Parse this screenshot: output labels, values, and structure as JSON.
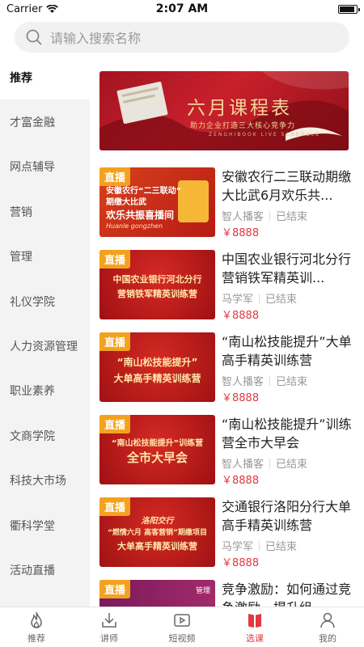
{
  "status": {
    "carrier": "Carrier",
    "time": "2:07 AM"
  },
  "search": {
    "placeholder": "请输入搜索名称"
  },
  "sidebar": {
    "items": [
      {
        "label": "推荐"
      },
      {
        "label": "才富金融"
      },
      {
        "label": "网点辅导"
      },
      {
        "label": "营销"
      },
      {
        "label": "管理"
      },
      {
        "label": "礼仪学院"
      },
      {
        "label": "人力资源管理"
      },
      {
        "label": "职业素养"
      },
      {
        "label": "文商学院"
      },
      {
        "label": "科技大市场"
      },
      {
        "label": "衢科学堂"
      },
      {
        "label": "活动直播"
      }
    ]
  },
  "banner": {
    "title": "六月课程表",
    "subtitle": "助力企业打造三大核心竞争力",
    "subtitle2": "ZENGHIBOOK LIVE SCHEDULE"
  },
  "courses": [
    {
      "badge": "直播",
      "title": "安徽农行二三联动期缴大比武6月欢乐共...",
      "author": "智人播客",
      "status": "已结束",
      "price": "￥8888",
      "thumb_lines": [
        "安徽农行“二三联动”",
        "期缴大比武",
        "欢乐共振喜播间",
        "Huanle gongzhen"
      ]
    },
    {
      "badge": "直播",
      "title": "中国农业银行河北分行营销铁军精英训...",
      "author": "马学军",
      "status": "已结束",
      "price": "￥8888",
      "thumb_lines": [
        "中国农业银行河北分行",
        "营销铁军精英训练营"
      ]
    },
    {
      "badge": "直播",
      "title": "“南山松技能提升”大单高手精英训练营",
      "author": "智人播客",
      "status": "已结束",
      "price": "￥8888",
      "thumb_lines": [
        "“南山松技能提升”",
        "大单高手精英训练营"
      ]
    },
    {
      "badge": "直播",
      "title": "“南山松技能提升”训练营全市大早会",
      "author": "智人播客",
      "status": "已结束",
      "price": "￥8888",
      "thumb_lines": [
        "“南山松技能提升”训练营",
        "全市大早会"
      ]
    },
    {
      "badge": "直播",
      "title": "交通银行洛阳分行大单高手精英训练营",
      "author": "马学军",
      "status": "已结束",
      "price": "￥8888",
      "thumb_lines": [
        "洛阳交行",
        "“燃情六月 高客营销”期缴项目",
        "大单高手精英训练营"
      ]
    },
    {
      "badge": "直播",
      "title": "竞争激励：如何通过竞争激励，提升组...",
      "author": "",
      "status": "",
      "price": "",
      "thumb_lines": [
        "管理"
      ]
    }
  ],
  "tabbar": {
    "items": [
      {
        "label": "推荐",
        "icon": "flame-icon"
      },
      {
        "label": "讲师",
        "icon": "download-icon"
      },
      {
        "label": "短视频",
        "icon": "video-icon"
      },
      {
        "label": "选课",
        "icon": "book-icon"
      },
      {
        "label": "我的",
        "icon": "person-icon"
      }
    ]
  },
  "colors": {
    "accent": "#e0393e",
    "badge": "#f3a21e"
  }
}
